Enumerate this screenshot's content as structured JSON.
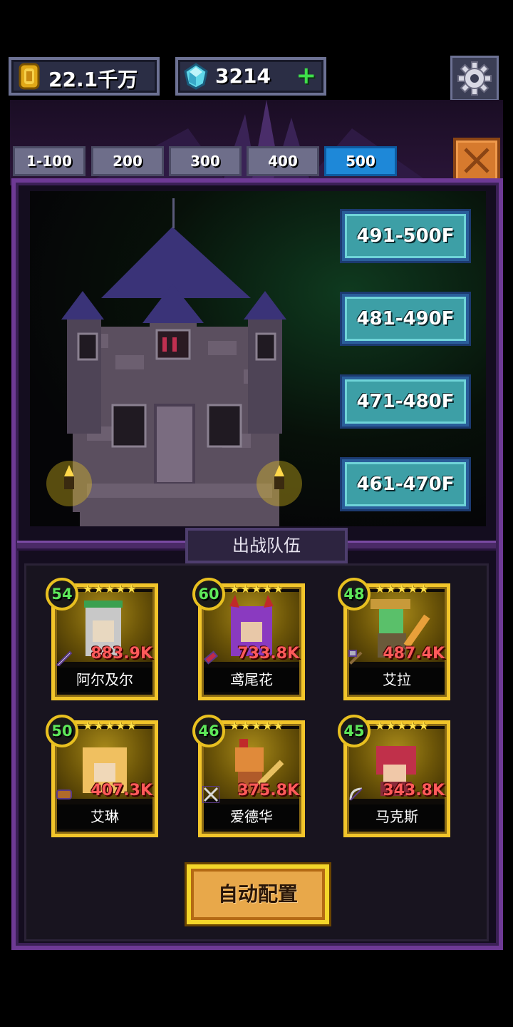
{
  "resources": {
    "gold": {
      "value": "22.1千万",
      "icon": "gold-coin-icon"
    },
    "gems": {
      "value": "3214",
      "icon": "diamond-icon",
      "add_label": "+"
    }
  },
  "settings_icon": "gear-icon",
  "close_icon": "close-x-icon",
  "tabs": [
    {
      "label": "1-100",
      "active": false
    },
    {
      "label": "200",
      "active": false
    },
    {
      "label": "300",
      "active": false
    },
    {
      "label": "400",
      "active": false
    },
    {
      "label": "500",
      "active": true
    }
  ],
  "floors": [
    {
      "label": "491-500F"
    },
    {
      "label": "481-490F"
    },
    {
      "label": "471-480F"
    },
    {
      "label": "461-470F"
    }
  ],
  "team": {
    "title": "出战队伍",
    "heroes": [
      {
        "name": "阿尔及尔",
        "level": "54",
        "power": "883.9K",
        "stars": "★★★★★",
        "weapon": "quill-icon"
      },
      {
        "name": "鸢尾花",
        "level": "60",
        "power": "733.8K",
        "stars": "★★★★★",
        "weapon": "gem-wand-icon"
      },
      {
        "name": "艾拉",
        "level": "48",
        "power": "487.4K",
        "stars": "★★★★★",
        "weapon": "axe-icon"
      },
      {
        "name": "艾琳",
        "level": "50",
        "power": "407.3K",
        "stars": "★★★★★",
        "weapon": "shield-icon"
      },
      {
        "name": "爱德华",
        "level": "46",
        "power": "375.8K",
        "stars": "★★★★★",
        "weapon": "crossed-swords-icon"
      },
      {
        "name": "马克斯",
        "level": "45",
        "power": "343.8K",
        "stars": "★★★★★",
        "weapon": "bow-icon"
      }
    ]
  },
  "auto_button": {
    "label": "自动配置"
  },
  "colors": {
    "active_tab": "#1e88d8",
    "floor_button": "#3d9fa6",
    "panel_border": "#6e3a95",
    "card_border": "#f2c52a",
    "power_text": "#ff5a5a",
    "level_text": "#5ee85a",
    "auto_button": "#e8a84a"
  }
}
